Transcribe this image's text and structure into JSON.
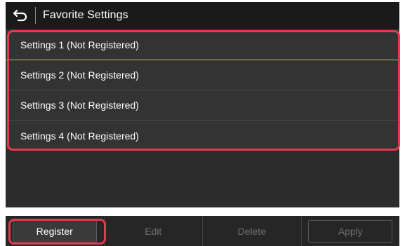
{
  "header": {
    "back_icon": "back-arrow-icon",
    "title": "Favorite Settings"
  },
  "settings_list": [
    {
      "label": "Settings 1 (Not Registered)"
    },
    {
      "label": "Settings 2 (Not Registered)"
    },
    {
      "label": "Settings 3 (Not Registered)"
    },
    {
      "label": "Settings 4 (Not Registered)"
    }
  ],
  "footer": {
    "register_label": "Register",
    "edit_label": "Edit",
    "delete_label": "Delete",
    "apply_label": "Apply"
  },
  "colors": {
    "highlight": "#e23a4b",
    "selected_divider": "#c7b25a",
    "header_bg": "#1a1a1a",
    "list_bg": "#333333"
  }
}
